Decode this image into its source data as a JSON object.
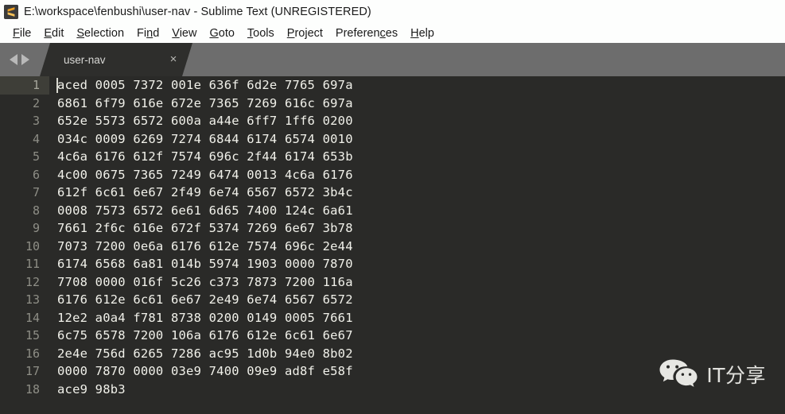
{
  "window": {
    "title": "E:\\workspace\\fenbushi\\user-nav - Sublime Text (UNREGISTERED)",
    "app_icon": "sublime-text-icon"
  },
  "menubar": {
    "items": [
      {
        "label": "File",
        "accel_index": 0
      },
      {
        "label": "Edit",
        "accel_index": 0
      },
      {
        "label": "Selection",
        "accel_index": 0
      },
      {
        "label": "Find",
        "accel_index": 2
      },
      {
        "label": "View",
        "accel_index": 0
      },
      {
        "label": "Goto",
        "accel_index": 0
      },
      {
        "label": "Tools",
        "accel_index": 0
      },
      {
        "label": "Project",
        "accel_index": 0
      },
      {
        "label": "Preferences",
        "accel_index": 8
      },
      {
        "label": "Help",
        "accel_index": 0
      }
    ]
  },
  "tabbar": {
    "nav_prev": "prev-tab-arrow",
    "nav_next": "next-tab-arrow",
    "tabs": [
      {
        "label": "user-nav",
        "close_label": "×",
        "active": true
      }
    ]
  },
  "editor": {
    "active_line": 1,
    "lines": [
      {
        "number": "1",
        "text": "aced 0005 7372 001e 636f 6d2e 7765 697a"
      },
      {
        "number": "2",
        "text": "6861 6f79 616e 672e 7365 7269 616c 697a"
      },
      {
        "number": "3",
        "text": "652e 5573 6572 600a a44e 6ff7 1ff6 0200"
      },
      {
        "number": "4",
        "text": "034c 0009 6269 7274 6844 6174 6574 0010"
      },
      {
        "number": "5",
        "text": "4c6a 6176 612f 7574 696c 2f44 6174 653b"
      },
      {
        "number": "6",
        "text": "4c00 0675 7365 7249 6474 0013 4c6a 6176"
      },
      {
        "number": "7",
        "text": "612f 6c61 6e67 2f49 6e74 6567 6572 3b4c"
      },
      {
        "number": "8",
        "text": "0008 7573 6572 6e61 6d65 7400 124c 6a61"
      },
      {
        "number": "9",
        "text": "7661 2f6c 616e 672f 5374 7269 6e67 3b78"
      },
      {
        "number": "10",
        "text": "7073 7200 0e6a 6176 612e 7574 696c 2e44"
      },
      {
        "number": "11",
        "text": "6174 6568 6a81 014b 5974 1903 0000 7870"
      },
      {
        "number": "12",
        "text": "7708 0000 016f 5c26 c373 7873 7200 116a"
      },
      {
        "number": "13",
        "text": "6176 612e 6c61 6e67 2e49 6e74 6567 6572"
      },
      {
        "number": "14",
        "text": "12e2 a0a4 f781 8738 0200 0149 0005 7661"
      },
      {
        "number": "15",
        "text": "6c75 6578 7200 106a 6176 612e 6c61 6e67"
      },
      {
        "number": "16",
        "text": "2e4e 756d 6265 7286 ac95 1d0b 94e0 8b02"
      },
      {
        "number": "17",
        "text": "0000 7870 0000 03e9 7400 09e9 ad8f e58f"
      },
      {
        "number": "18",
        "text": "ace9 98b3"
      }
    ]
  },
  "watermark": {
    "icon": "wechat-icon",
    "text": "IT分享"
  },
  "colors": {
    "titlebar_bg": "#fdfefd",
    "menubar_bg": "#fdfefd",
    "tabbar_bg": "#6d6d6d",
    "tab_active_bg": "#2e2e2c",
    "editor_bg": "#2a2a28",
    "text_fg": "#f1f1ea",
    "gutter_fg": "#8e8e86",
    "active_line_bg": "#3e3e38",
    "icon_accent": "#ef9f22"
  }
}
